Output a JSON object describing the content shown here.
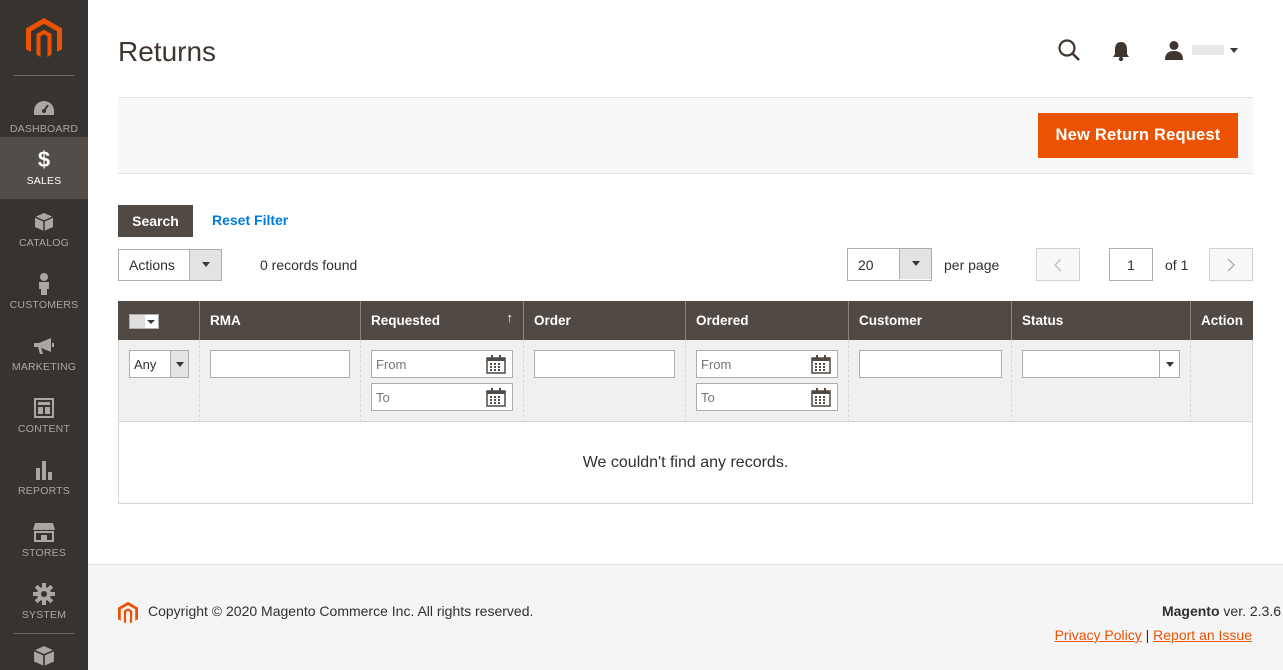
{
  "sidebar": {
    "items": [
      {
        "label": "DASHBOARD",
        "icon": "dashboard-icon",
        "active": false
      },
      {
        "label": "SALES",
        "icon": "dollar-icon",
        "active": true
      },
      {
        "label": "CATALOG",
        "icon": "box-icon",
        "active": false
      },
      {
        "label": "CUSTOMERS",
        "icon": "person-icon",
        "active": false
      },
      {
        "label": "MARKETING",
        "icon": "megaphone-icon",
        "active": false
      },
      {
        "label": "CONTENT",
        "icon": "layout-icon",
        "active": false
      },
      {
        "label": "REPORTS",
        "icon": "bar-chart-icon",
        "active": false
      },
      {
        "label": "STORES",
        "icon": "storefront-icon",
        "active": false
      },
      {
        "label": "SYSTEM",
        "icon": "gear-icon",
        "active": false
      }
    ]
  },
  "header": {
    "title": "Returns"
  },
  "action_bar": {
    "new_button": "New Return Request"
  },
  "filters": {
    "search_button": "Search",
    "reset_link": "Reset Filter"
  },
  "toolbar": {
    "actions_label": "Actions",
    "records_found": "0 records found",
    "per_page_value": "20",
    "per_page_label": "per page",
    "page_value": "1",
    "page_of": "of 1"
  },
  "grid": {
    "columns": [
      "RMA",
      "Requested",
      "Order",
      "Ordered",
      "Customer",
      "Status",
      "Action"
    ],
    "any_label": "Any",
    "from_placeholder": "From",
    "to_placeholder": "To",
    "empty_message": "We couldn't find any records."
  },
  "footer": {
    "copyright": "Copyright © 2020 Magento Commerce Inc. All rights reserved.",
    "brand": "Magento",
    "version": " ver. 2.3.6",
    "privacy_link": "Privacy Policy",
    "separator": "|",
    "report_link": "Report an Issue"
  },
  "colors": {
    "primary": "#eb5202",
    "sidebar_bg": "#373330",
    "grid_head": "#514943",
    "link": "#007bdb"
  }
}
